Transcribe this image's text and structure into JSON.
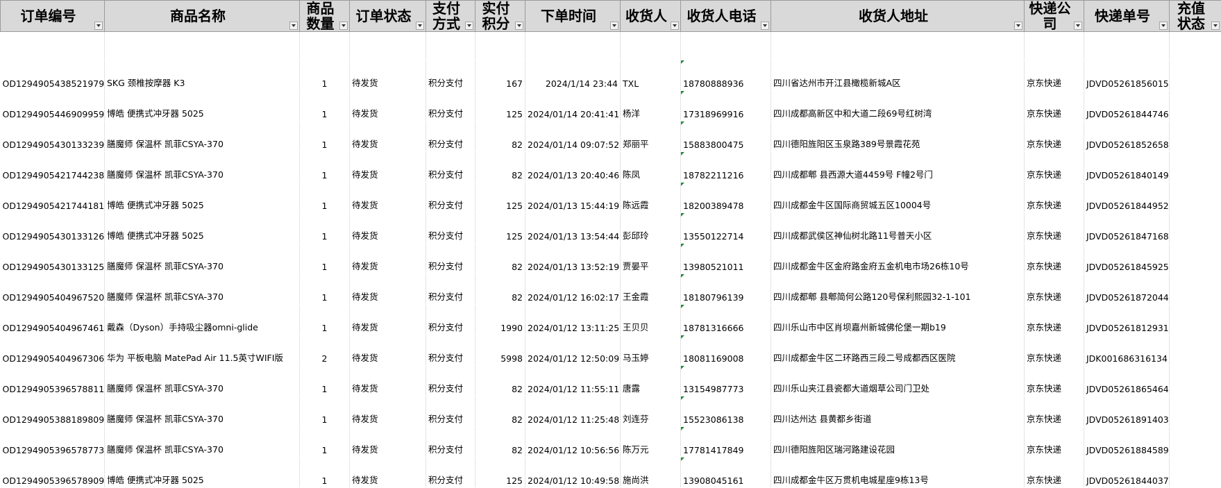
{
  "headers": [
    {
      "key": "order_id",
      "label": "订单编号"
    },
    {
      "key": "product",
      "label": "商品名称"
    },
    {
      "key": "qty",
      "label": "商品数量"
    },
    {
      "key": "status",
      "label": "订单状态"
    },
    {
      "key": "pay",
      "label": "支付方式"
    },
    {
      "key": "points",
      "label": "实付积分"
    },
    {
      "key": "time",
      "label": "下单时间"
    },
    {
      "key": "receiver",
      "label": "收货人"
    },
    {
      "key": "phone",
      "label": "收货人电话"
    },
    {
      "key": "address",
      "label": "收货人地址"
    },
    {
      "key": "courier",
      "label": "快递公司"
    },
    {
      "key": "tracking",
      "label": "快递单号"
    },
    {
      "key": "topup",
      "label": "充值状态"
    }
  ],
  "rows": [
    {
      "order_id": "OD1294905438521979",
      "product": "SKG 颈椎按摩器 K3",
      "qty": "1",
      "status": "待发货",
      "pay": "积分支付",
      "points": "167",
      "time": "2024/1/14 23:44",
      "receiver": "TXL",
      "phone": "18780888936",
      "address": "四川省达州市开江县橄榄新城A区",
      "courier": "京东快递",
      "tracking": "JDVD05261856015",
      "topup": ""
    },
    {
      "order_id": "OD1294905446909959",
      "product": "博皓 便携式冲牙器 5025",
      "qty": "1",
      "status": "待发货",
      "pay": "积分支付",
      "points": "125",
      "time": "2024/01/14 20:41:41",
      "receiver": "杨洋",
      "phone": "17318969916",
      "address": "四川成都高新区中和大道二段69号红树湾",
      "courier": "京东快递",
      "tracking": "JDVD05261844746",
      "topup": ""
    },
    {
      "order_id": "OD1294905430133239",
      "product": "膳魔师 保温杯 凯菲CSYA-370",
      "qty": "1",
      "status": "待发货",
      "pay": "积分支付",
      "points": "82",
      "time": "2024/01/14 09:07:52",
      "receiver": "郑丽平",
      "phone": "15883800475",
      "address": "四川德阳旌阳区玉泉路389号景霞花苑",
      "courier": "京东快递",
      "tracking": "JDVD05261852658",
      "topup": ""
    },
    {
      "order_id": "OD1294905421744238",
      "product": "膳魔师 保温杯 凯菲CSYA-370",
      "qty": "1",
      "status": "待发货",
      "pay": "积分支付",
      "points": "82",
      "time": "2024/01/13 20:40:46",
      "receiver": "陈凤",
      "phone": "18782211216",
      "address": "四川成都郫 县西源大道4459号 F幢2号门",
      "courier": "京东快递",
      "tracking": "JDVD05261840149",
      "topup": ""
    },
    {
      "order_id": "OD1294905421744181",
      "product": "博皓 便携式冲牙器 5025",
      "qty": "1",
      "status": "待发货",
      "pay": "积分支付",
      "points": "125",
      "time": "2024/01/13 15:44:19",
      "receiver": "陈远霞",
      "phone": "18200389478",
      "address": "四川成都金牛区国际商贸城五区10004号",
      "courier": "京东快递",
      "tracking": "JDVD05261844952",
      "topup": ""
    },
    {
      "order_id": "OD1294905430133126",
      "product": "博皓 便携式冲牙器 5025",
      "qty": "1",
      "status": "待发货",
      "pay": "积分支付",
      "points": "125",
      "time": "2024/01/13 13:54:44",
      "receiver": "彭邱玲",
      "phone": "13550122714",
      "address": "四川成都武侯区神仙树北路11号普天小区",
      "courier": "京东快递",
      "tracking": "JDVD05261847168",
      "topup": ""
    },
    {
      "order_id": "OD1294905430133125",
      "product": "膳魔师 保温杯 凯菲CSYA-370",
      "qty": "1",
      "status": "待发货",
      "pay": "积分支付",
      "points": "82",
      "time": "2024/01/13 13:52:19",
      "receiver": "贾晏平",
      "phone": "13980521011",
      "address": "四川成都金牛区金府路金府五金机电市场26栋10号",
      "courier": "京东快递",
      "tracking": "JDVD05261845925",
      "topup": ""
    },
    {
      "order_id": "OD1294905404967520",
      "product": "膳魔师 保温杯 凯菲CSYA-370",
      "qty": "1",
      "status": "待发货",
      "pay": "积分支付",
      "points": "82",
      "time": "2024/01/12 16:02:17",
      "receiver": "王金霞",
      "phone": "18180796139",
      "address": "四川成都郫 县郫简何公路120号保利熙园32-1-101",
      "courier": "京东快递",
      "tracking": "JDVD05261872044",
      "topup": ""
    },
    {
      "order_id": "OD1294905404967461",
      "product": "戴森（Dyson）手持吸尘器omni-glide",
      "qty": "1",
      "status": "待发货",
      "pay": "积分支付",
      "points": "1990",
      "time": "2024/01/12 13:11:25",
      "receiver": "王贝贝",
      "phone": "18781316666",
      "address": "四川乐山市中区肖坝嘉州新城佛伦堡一期b19",
      "courier": "京东快递",
      "tracking": "JDVD05261812931",
      "topup": ""
    },
    {
      "order_id": "OD1294905404967306",
      "product": "华为 平板电脑 MatePad Air 11.5英寸WIFI版",
      "qty": "2",
      "status": "待发货",
      "pay": "积分支付",
      "points": "5998",
      "time": "2024/01/12 12:50:09",
      "receiver": "马玉婷",
      "phone": "18081169008",
      "address": "四川成都金牛区二环路西三段二号成都西区医院",
      "courier": "京东快递",
      "tracking": "JDK001686316134",
      "topup": ""
    },
    {
      "order_id": "OD1294905396578811",
      "product": "膳魔师 保温杯 凯菲CSYA-370",
      "qty": "1",
      "status": "待发货",
      "pay": "积分支付",
      "points": "82",
      "time": "2024/01/12 11:55:11",
      "receiver": "唐露",
      "phone": "13154987773",
      "address": "四川乐山夹江县瓷都大道烟草公司门卫处",
      "courier": "京东快递",
      "tracking": "JDVD05261865464",
      "topup": ""
    },
    {
      "order_id": "OD1294905388189809",
      "product": "膳魔师 保温杯 凯菲CSYA-370",
      "qty": "1",
      "status": "待发货",
      "pay": "积分支付",
      "points": "82",
      "time": "2024/01/12 11:25:48",
      "receiver": "刘连芬",
      "phone": "15523086138",
      "address": "四川达州达 县黄都乡街道",
      "courier": "京东快递",
      "tracking": "JDVD05261891403",
      "topup": ""
    },
    {
      "order_id": "OD1294905396578773",
      "product": "膳魔师 保温杯 凯菲CSYA-370",
      "qty": "1",
      "status": "待发货",
      "pay": "积分支付",
      "points": "82",
      "time": "2024/01/12 10:56:56",
      "receiver": "陈万元",
      "phone": "17781417849",
      "address": "四川德阳旌阳区瑞河路建设花园",
      "courier": "京东快递",
      "tracking": "JDVD05261884589",
      "topup": ""
    },
    {
      "order_id": "OD1294905396578909",
      "product": "博皓 便携式冲牙器 5025",
      "qty": "1",
      "status": "待发货",
      "pay": "积分支付",
      "points": "125",
      "time": "2024/01/12 10:49:58",
      "receiver": "施尚洪",
      "phone": "13908045161",
      "address": "四川成都金牛区万贯机电城星座9栋13号",
      "courier": "京东快递",
      "tracking": "JDVD05261844037",
      "topup": ""
    }
  ]
}
